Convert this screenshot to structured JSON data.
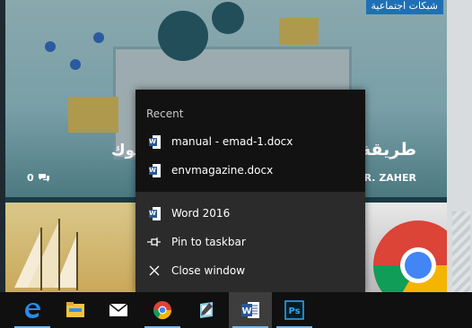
{
  "page": {
    "tag": "شبكات اجتماعية",
    "headline_left": "بوك",
    "headline_right": "طريقة الت",
    "comments_count": "0",
    "author": "MR. ZAHER"
  },
  "jumplist": {
    "recent_header": "Recent",
    "recent_items": [
      {
        "label": "manual - emad-1.docx",
        "icon": "word-doc-icon"
      },
      {
        "label": "envmagazine.docx",
        "icon": "word-doc-icon"
      }
    ],
    "tasks": [
      {
        "label": "Word 2016",
        "icon": "word-app-icon"
      },
      {
        "label": "Pin to taskbar",
        "icon": "pin-icon"
      },
      {
        "label": "Close window",
        "icon": "close-icon"
      }
    ]
  },
  "taskbar": {
    "apps": [
      {
        "name": "Microsoft Edge",
        "icon": "edge-icon"
      },
      {
        "name": "File Explorer",
        "icon": "file-explorer-icon"
      },
      {
        "name": "Mail",
        "icon": "mail-icon"
      },
      {
        "name": "Google Chrome",
        "icon": "chrome-icon"
      },
      {
        "name": "Notepad",
        "icon": "notepad-icon"
      },
      {
        "name": "Microsoft Word",
        "icon": "word-icon"
      },
      {
        "name": "Adobe Photoshop",
        "icon": "photoshop-icon",
        "label": "Ps"
      }
    ]
  },
  "colors": {
    "taskbar_bg": "#101010",
    "jumplist_bg": "#2b2b2b",
    "recent_bg": "#121212",
    "accent": "#76b9ed",
    "word_blue": "#2b5797",
    "tag_blue": "#1f6fb6"
  }
}
